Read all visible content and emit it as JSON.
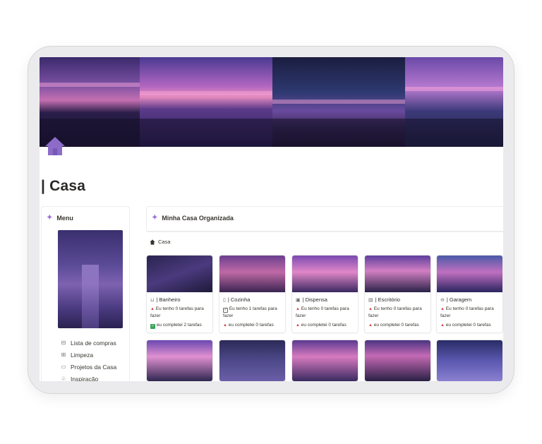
{
  "page": {
    "title": "| Casa",
    "home_icon": "house-icon"
  },
  "menu": {
    "title": "Menu",
    "items": [
      {
        "label": "Lista de compras",
        "icon": "shopping-basket-icon"
      },
      {
        "label": "Limpeza",
        "icon": "broom-icon"
      },
      {
        "label": "Projetos da Casa",
        "icon": "sofa-icon"
      },
      {
        "label": "Inspiração",
        "icon": "plant-icon"
      }
    ]
  },
  "main": {
    "title": "Minha Casa Organizada"
  },
  "breadcrumb": {
    "label": "Casa"
  },
  "rooms": [
    {
      "name": "| Banheiro",
      "icon": "bathtub-icon",
      "todo": "Eu tenho 0 tarefas para fazer",
      "done": "eu completei 2 tarefas",
      "todo_mark": "triangle",
      "done_mark": "check"
    },
    {
      "name": "| Cozinha",
      "icon": "fridge-icon",
      "todo": "Eu tenho 1 tarefas para fazer",
      "done": "eu completei 0 tarefas",
      "todo_mark": "box",
      "done_mark": "triangle"
    },
    {
      "name": "| Dispensa",
      "icon": "box-icon",
      "todo": "Eu tenho 0 tarefas para fazer",
      "done": "eu completei 0 tarefas",
      "todo_mark": "triangle",
      "done_mark": "triangle"
    },
    {
      "name": "| Escritório",
      "icon": "document-icon",
      "todo": "Eu tenho 0 tarefas para fazer",
      "done": "eu completei 0 tarefas",
      "todo_mark": "triangle",
      "done_mark": "triangle"
    },
    {
      "name": "| Garagem",
      "icon": "car-icon",
      "todo": "Eu tenho 0 tarefas para fazer",
      "done": "eu completei 0 tarefas",
      "todo_mark": "triangle",
      "done_mark": "triangle"
    }
  ]
}
